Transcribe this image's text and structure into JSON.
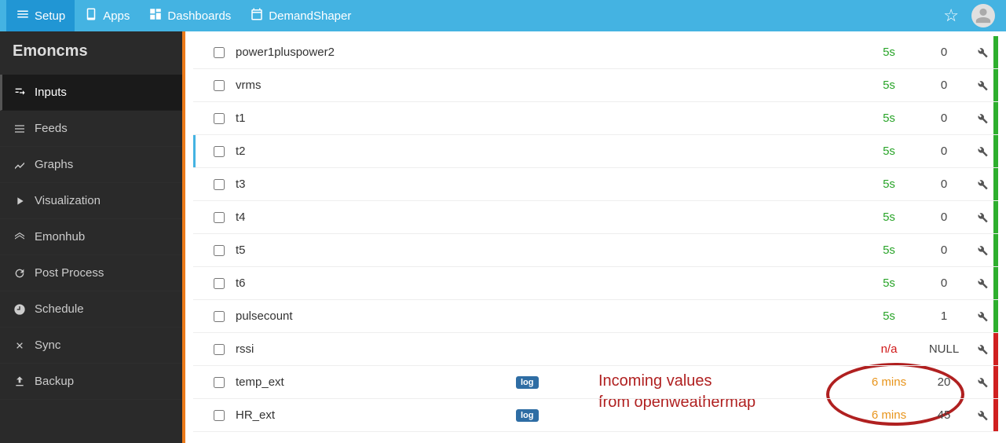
{
  "topbar": {
    "setup": "Setup",
    "apps": "Apps",
    "dashboards": "Dashboards",
    "demandshaper": "DemandShaper"
  },
  "sidebar": {
    "brand": "Emoncms",
    "items": [
      {
        "label": "Inputs"
      },
      {
        "label": "Feeds"
      },
      {
        "label": "Graphs"
      },
      {
        "label": "Visualization"
      },
      {
        "label": "Emonhub"
      },
      {
        "label": "Post Process"
      },
      {
        "label": "Schedule"
      },
      {
        "label": "Sync"
      },
      {
        "label": "Backup"
      }
    ]
  },
  "rows": [
    {
      "name": "power1pluspower2",
      "badge": "",
      "time": "5s",
      "time_cls": "green",
      "value": "0",
      "stripe": "green",
      "marked": false
    },
    {
      "name": "vrms",
      "badge": "",
      "time": "5s",
      "time_cls": "green",
      "value": "0",
      "stripe": "green",
      "marked": false
    },
    {
      "name": "t1",
      "badge": "",
      "time": "5s",
      "time_cls": "green",
      "value": "0",
      "stripe": "green",
      "marked": false
    },
    {
      "name": "t2",
      "badge": "",
      "time": "5s",
      "time_cls": "green",
      "value": "0",
      "stripe": "green",
      "marked": true
    },
    {
      "name": "t3",
      "badge": "",
      "time": "5s",
      "time_cls": "green",
      "value": "0",
      "stripe": "green",
      "marked": false
    },
    {
      "name": "t4",
      "badge": "",
      "time": "5s",
      "time_cls": "green",
      "value": "0",
      "stripe": "green",
      "marked": false
    },
    {
      "name": "t5",
      "badge": "",
      "time": "5s",
      "time_cls": "green",
      "value": "0",
      "stripe": "green",
      "marked": false
    },
    {
      "name": "t6",
      "badge": "",
      "time": "5s",
      "time_cls": "green",
      "value": "0",
      "stripe": "green",
      "marked": false
    },
    {
      "name": "pulsecount",
      "badge": "",
      "time": "5s",
      "time_cls": "green",
      "value": "1",
      "stripe": "green",
      "marked": false
    },
    {
      "name": "rssi",
      "badge": "",
      "time": "n/a",
      "time_cls": "red",
      "value": "NULL",
      "stripe": "red",
      "marked": false
    },
    {
      "name": "temp_ext",
      "badge": "log",
      "time": "6 mins",
      "time_cls": "orange",
      "value": "20",
      "stripe": "red",
      "marked": false
    },
    {
      "name": "HR_ext",
      "badge": "log",
      "time": "6 mins",
      "time_cls": "orange",
      "value": "45",
      "stripe": "red",
      "marked": false
    }
  ],
  "annotation": {
    "line1": "Incoming values",
    "line2": "from openweathermap"
  }
}
